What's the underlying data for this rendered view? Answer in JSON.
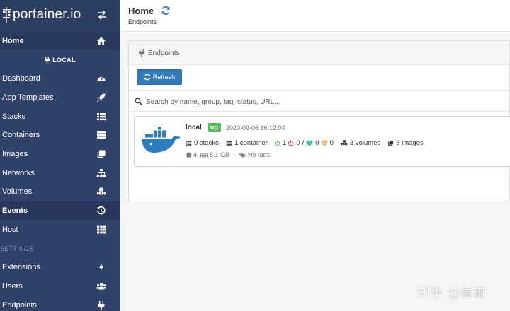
{
  "sidebar": {
    "brand": "portainer.io",
    "home_label": "Home",
    "environment_label": "LOCAL",
    "items": [
      {
        "label": "Dashboard"
      },
      {
        "label": "App Templates"
      },
      {
        "label": "Stacks"
      },
      {
        "label": "Containers"
      },
      {
        "label": "Images"
      },
      {
        "label": "Networks"
      },
      {
        "label": "Volumes"
      },
      {
        "label": "Events"
      },
      {
        "label": "Host"
      }
    ],
    "settings_heading": "SETTINGS",
    "settings_items": [
      {
        "label": "Extensions"
      },
      {
        "label": "Users"
      },
      {
        "label": "Endpoints"
      }
    ]
  },
  "header": {
    "title": "Home",
    "breadcrumb": "Endpoints"
  },
  "widget": {
    "title": "Endpoints",
    "refresh_label": "Refresh",
    "search_placeholder": "Search by name, group, tag, status, URL..."
  },
  "endpoint": {
    "name": "local",
    "status": "up",
    "date": "2020-09-06 16:12:04",
    "stacks": "0 stacks",
    "containers": "1 container",
    "running": "1",
    "stopped": "0",
    "separator": "/",
    "healthy": "0",
    "unhealthy": "0",
    "volumes": "3 volumes",
    "images": "6 images",
    "cpu": "4",
    "memory": "8.1 GB",
    "tags": "No tags"
  },
  "watermark": "知乎 @星甫",
  "colors": {
    "sidebar_bg": "#30426a",
    "primary": "#337ab7",
    "status_up": "#5cb85c",
    "docker_blue": "#2f7bbf",
    "running_green": "#5cb85c",
    "stopped_red": "#d9534f",
    "healthy_teal": "#1abc9c",
    "unhealthy_orange": "#f0ad4e"
  }
}
